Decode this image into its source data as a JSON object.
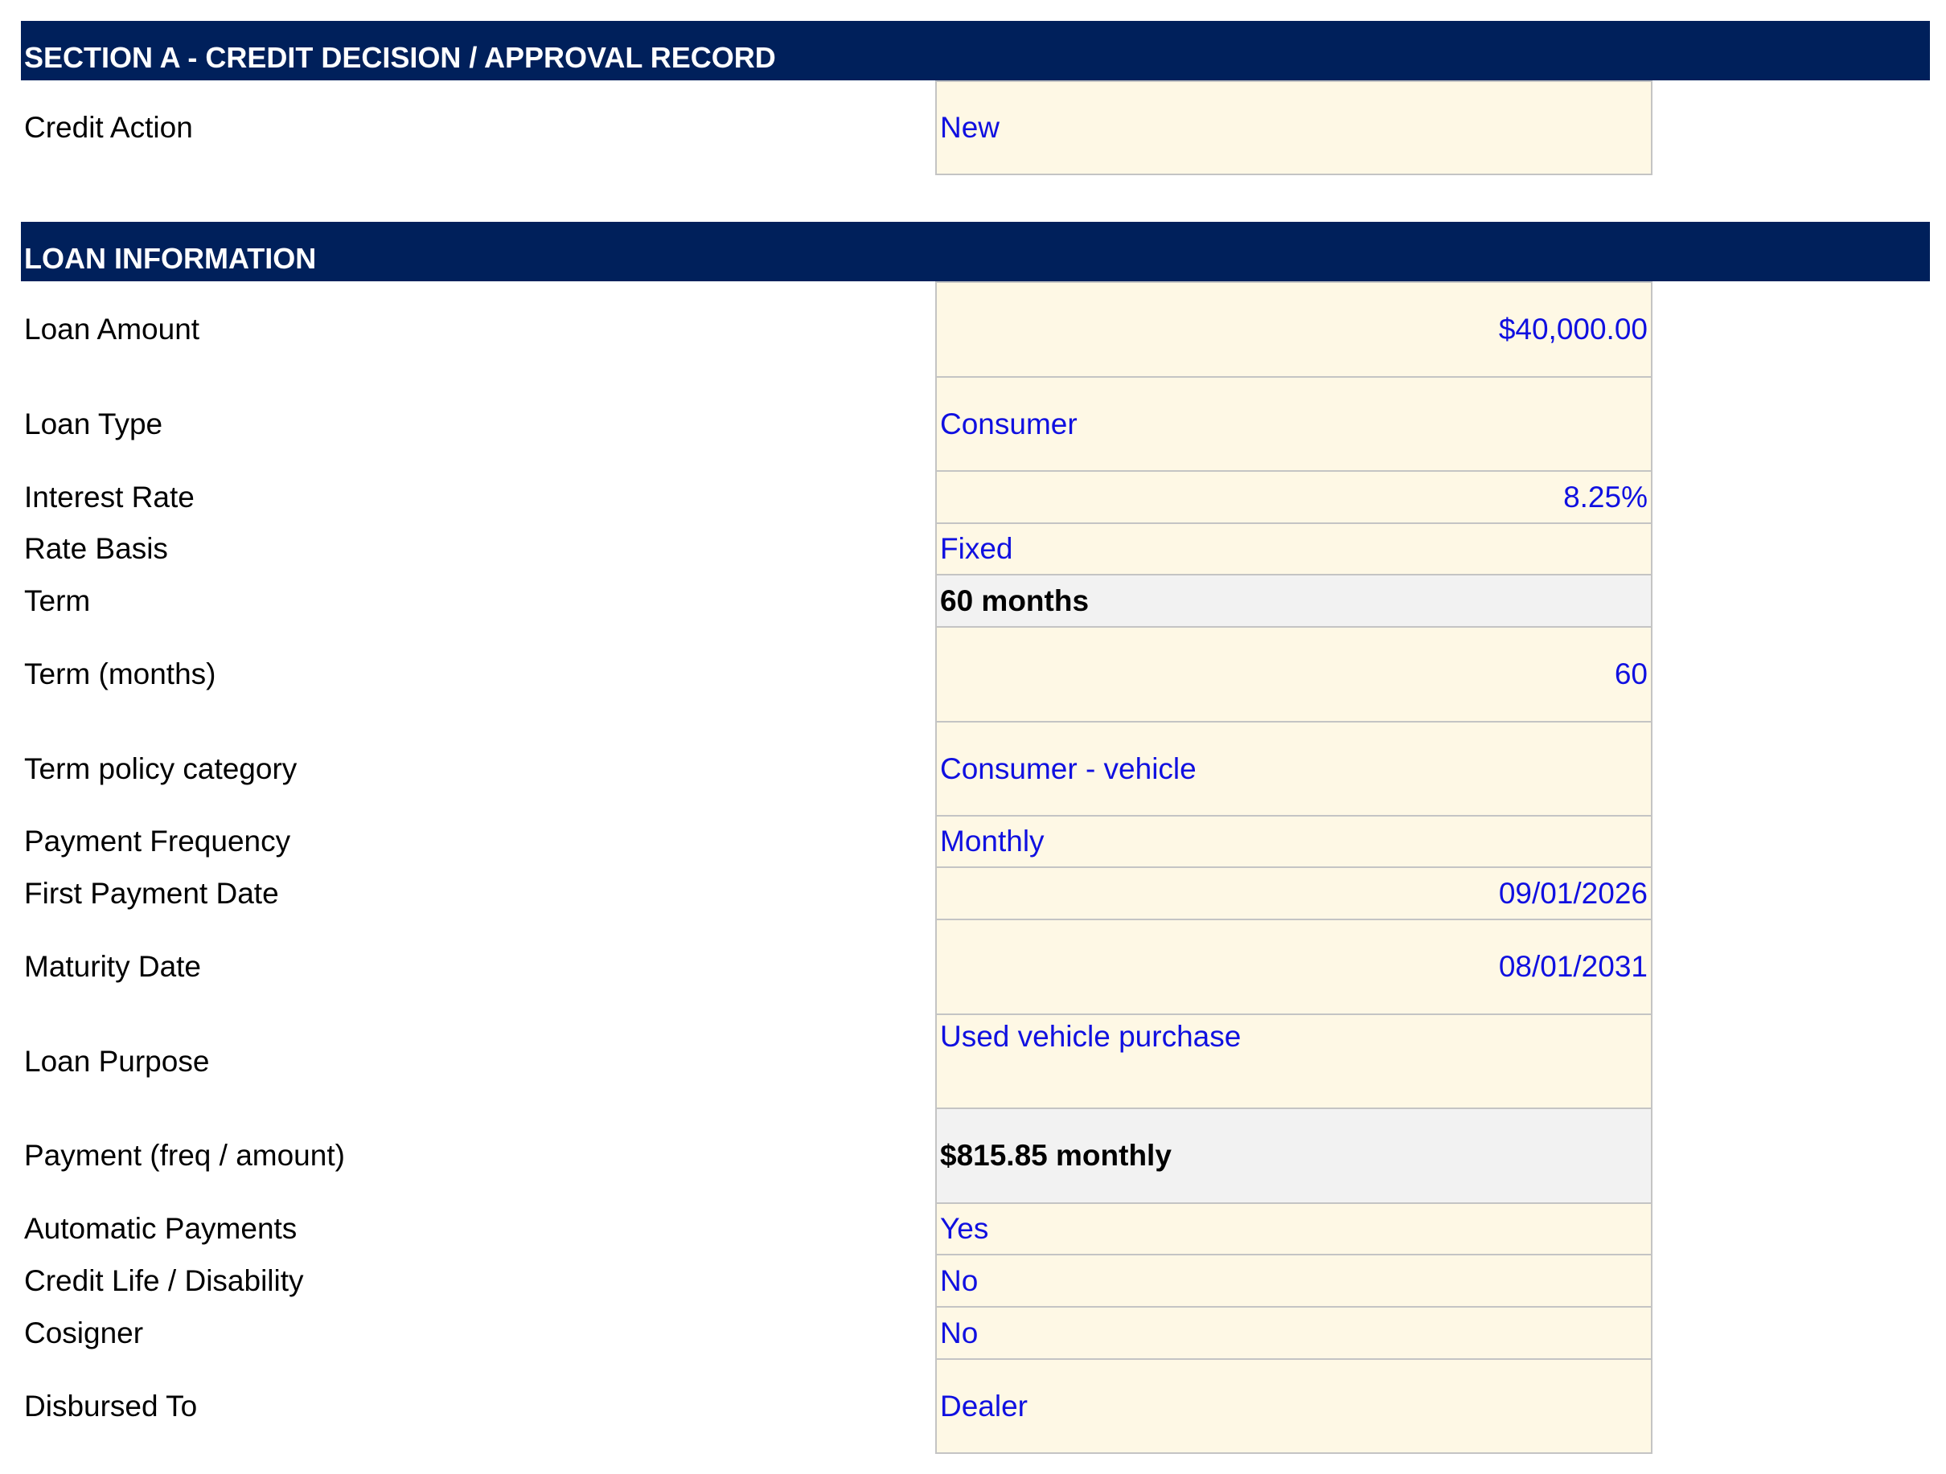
{
  "section_a": {
    "title": "SECTION A - CREDIT DECISION / APPROVAL RECORD",
    "credit_action": {
      "label": "Credit Action",
      "value": "New"
    }
  },
  "loan_information": {
    "title": "LOAN INFORMATION",
    "fields": [
      {
        "label": "Loan Amount",
        "value": "$40,000.00"
      },
      {
        "label": "Loan Type",
        "value": "Consumer"
      },
      {
        "label": "Interest Rate",
        "value": "8.25%"
      },
      {
        "label": "Rate Basis",
        "value": "Fixed"
      },
      {
        "label": "Term",
        "value": "60 months"
      },
      {
        "label": "Term (months)",
        "value": "60"
      },
      {
        "label": "Term policy category",
        "value": "Consumer - vehicle"
      },
      {
        "label": "Payment Frequency",
        "value": "Monthly"
      },
      {
        "label": "First Payment Date",
        "value": "09/01/2026"
      },
      {
        "label": "Maturity Date",
        "value": "08/01/2031"
      },
      {
        "label": "Loan Purpose",
        "value": "Used vehicle purchase"
      },
      {
        "label": "Payment (freq / amount)",
        "value": "$815.85 monthly"
      },
      {
        "label": "Automatic Payments",
        "value": "Yes"
      },
      {
        "label": "Credit Life / Disability",
        "value": "No"
      },
      {
        "label": "Cosigner",
        "value": "No"
      },
      {
        "label": "Disbursed To",
        "value": "Dealer"
      }
    ]
  },
  "colors": {
    "header_bg": "#00205b",
    "input_cell_bg": "#fef8e5",
    "calc_cell_bg": "#f2f2f2",
    "input_text": "#1010e0"
  }
}
